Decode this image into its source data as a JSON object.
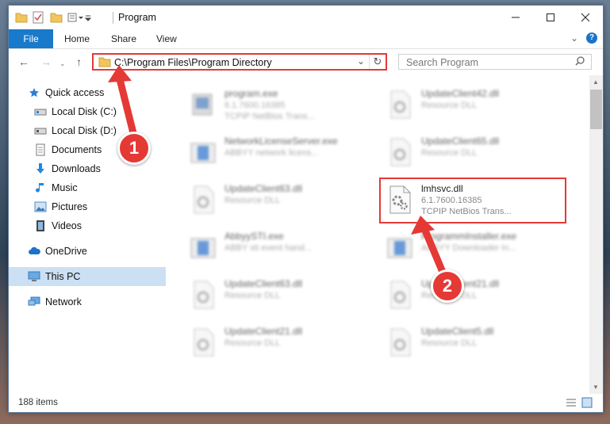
{
  "window": {
    "title": "Program"
  },
  "ribbon": {
    "file_tab": "File",
    "tabs": [
      "Home",
      "Share",
      "View"
    ]
  },
  "nav": {
    "address": "C:\\Program Files\\Program Directory",
    "search_placeholder": "Search Program"
  },
  "sidebar": {
    "items": [
      {
        "label": "Quick access",
        "icon": "star-icon"
      },
      {
        "label": "Local Disk (C:)",
        "icon": "drive-icon"
      },
      {
        "label": "Local Disk (D:)",
        "icon": "drive-icon"
      },
      {
        "label": "Documents",
        "icon": "documents-icon"
      },
      {
        "label": "Downloads",
        "icon": "download-icon"
      },
      {
        "label": "Music",
        "icon": "music-icon"
      },
      {
        "label": "Pictures",
        "icon": "pictures-icon"
      },
      {
        "label": "Videos",
        "icon": "videos-icon"
      },
      {
        "label": "OneDrive",
        "icon": "cloud-icon"
      },
      {
        "label": "This PC",
        "icon": "computer-icon"
      },
      {
        "label": "Network",
        "icon": "network-icon"
      }
    ]
  },
  "files": [
    {
      "name": "program.exe",
      "line2": "6.1.7600.16385",
      "line3": "TCPIP NetBios Trans..."
    },
    {
      "name": "UpdateClient42.dll",
      "line2": "Resource DLL",
      "line3": ""
    },
    {
      "name": "NetworkLicenseServer.exe",
      "line2": "ABBYY network licens...",
      "line3": ""
    },
    {
      "name": "UpdateClient65.dll",
      "line2": "Resource DLL",
      "line3": ""
    },
    {
      "name": "UpdateClient63.dll",
      "line2": "Resource DLL",
      "line3": ""
    },
    {
      "name": "lmhsvc.dll",
      "line2": "6.1.7600.16385",
      "line3": "TCPIP NetBios Trans..."
    },
    {
      "name": "AbbyySTI.exe",
      "line2": "ABBY sti event hand...",
      "line3": ""
    },
    {
      "name": "ProgrammInstaller.exe",
      "line2": "ABBYY Downloader In...",
      "line3": ""
    },
    {
      "name": "UpdateClient63.dll",
      "line2": "Resource DLL",
      "line3": ""
    },
    {
      "name": "UpdateClient21.dll",
      "line2": "Resource DLL",
      "line3": ""
    },
    {
      "name": "UpdateClient21.dll",
      "line2": "Resource DLL",
      "line3": ""
    },
    {
      "name": "UpdateClient5.dll",
      "line2": "Resource DLL",
      "line3": ""
    }
  ],
  "status": {
    "items": "188 items"
  },
  "annotations": {
    "step1": "1",
    "step2": "2",
    "color": "#e53935"
  }
}
